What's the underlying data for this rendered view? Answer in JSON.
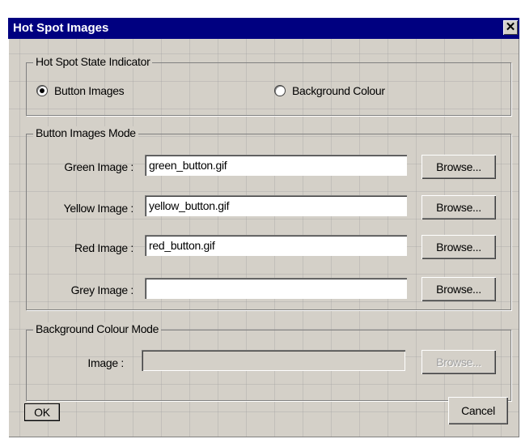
{
  "window": {
    "title": "Hot Spot Images",
    "close_glyph": "✕"
  },
  "state_group": {
    "legend": "Hot Spot State Indicator",
    "options": [
      {
        "label": "Button Images",
        "checked": true
      },
      {
        "label": "Background Colour",
        "checked": false
      }
    ]
  },
  "button_mode": {
    "legend": "Button Images Mode",
    "rows": [
      {
        "label": "Green Image :",
        "value": "green_button.gif",
        "browse": "Browse..."
      },
      {
        "label": "Yellow Image :",
        "value": "yellow_button.gif",
        "browse": "Browse..."
      },
      {
        "label": "Red Image :",
        "value": "red_button.gif",
        "browse": "Browse..."
      },
      {
        "label": "Grey Image :",
        "value": "",
        "browse": "Browse..."
      }
    ]
  },
  "bg_mode": {
    "legend": "Background Colour Mode",
    "label": "Image :",
    "value": "",
    "browse": "Browse..."
  },
  "footer": {
    "ok_label": "OK",
    "cancel_label": "Cancel"
  }
}
